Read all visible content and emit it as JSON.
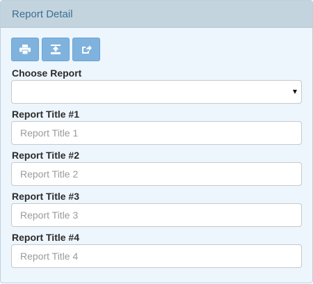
{
  "panel": {
    "title": "Report Detail",
    "header_bg": "#c3d4df",
    "body_bg": "#edf5fd",
    "title_color": "#3d6f92"
  },
  "toolbar": {
    "accent": "#7fb3de",
    "buttons": [
      {
        "icon": "print-icon"
      },
      {
        "icon": "export-icon"
      },
      {
        "icon": "share-icon"
      }
    ]
  },
  "form": {
    "choose_report_label": "Choose Report",
    "choose_report_value": "",
    "fields": [
      {
        "label": "Report Title #1",
        "placeholder": "Report Title 1",
        "value": ""
      },
      {
        "label": "Report Title #2",
        "placeholder": "Report Title 2",
        "value": ""
      },
      {
        "label": "Report Title #3",
        "placeholder": "Report Title 3",
        "value": ""
      },
      {
        "label": "Report Title #4",
        "placeholder": "Report Title 4",
        "value": ""
      }
    ]
  }
}
